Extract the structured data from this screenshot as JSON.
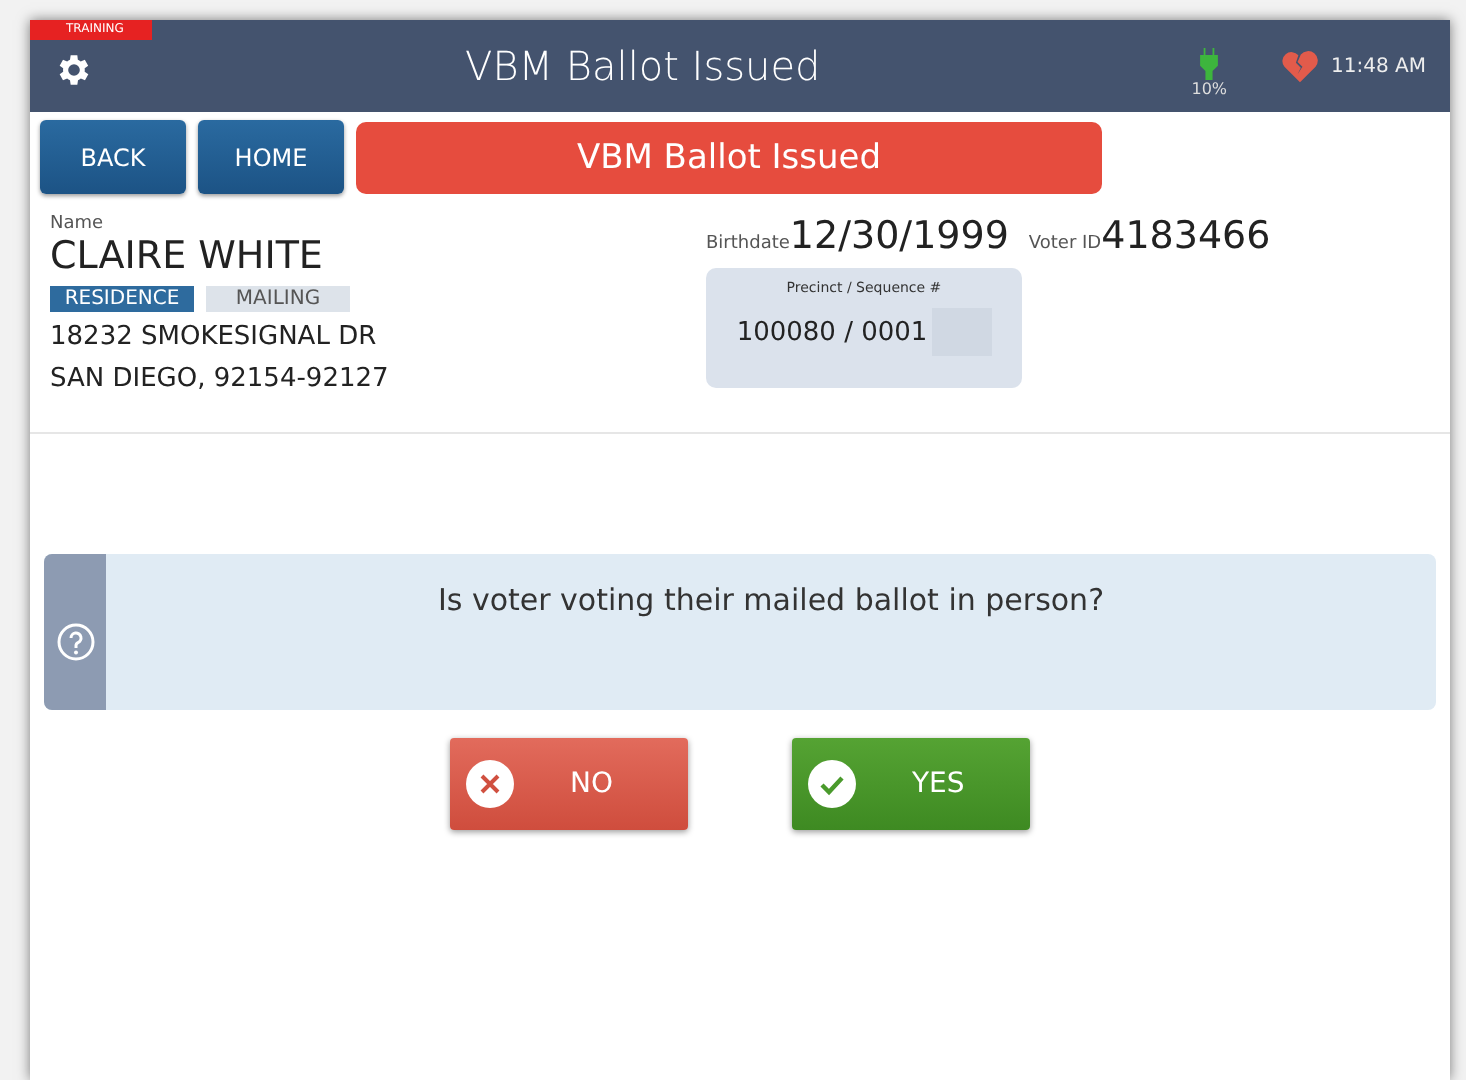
{
  "header": {
    "badge": "TRAINING",
    "title": "VBM Ballot Issued",
    "battery": "10%",
    "time": "11:48 AM"
  },
  "nav": {
    "buttons": [
      "BACK",
      "HOME"
    ],
    "banner": "VBM Ballot Issued"
  },
  "voter": {
    "name_label": "Name",
    "name": "CLAIRE WHITE",
    "birthdate_label": "Birthdate",
    "birthdate": "12/30/1999",
    "voter_id_label": "Voter ID",
    "voter_id": "4183466",
    "address_tabs": [
      {
        "label": "RESIDENCE",
        "selected": true
      },
      {
        "label": "MAILING",
        "selected": false
      }
    ],
    "address_lines": [
      "18232 SMOKESIGNAL DR",
      "SAN DIEGO, 92154-92127"
    ],
    "precinct_label": "Precinct / Sequence #",
    "precinct": "100080 / 0001"
  },
  "question": "Is voter voting their mailed ballot in person?",
  "answers": [
    {
      "label": "NO",
      "kind": "no"
    },
    {
      "label": "YES",
      "kind": "yes"
    }
  ]
}
